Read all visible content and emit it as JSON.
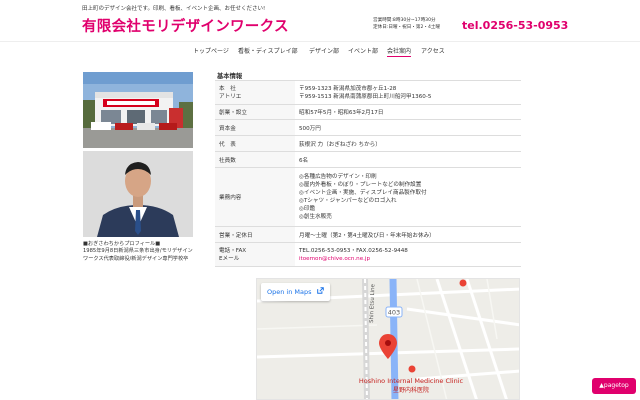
{
  "header": {
    "tagline": "田上町のデザイン会社です。印刷、看板、イベント企画、お任せください!",
    "title": "有限会社モリデザインワークス",
    "hours_line1": "営業時間:8時30分~17時30分",
    "hours_line2": "定休日:日曜・祝日・第2・4土曜",
    "phone": "tel.0256-53-0953"
  },
  "nav": {
    "items": [
      {
        "label": "トップページ"
      },
      {
        "label": "看板・ディスプレイ部"
      },
      {
        "label": "デザイン部"
      },
      {
        "label": "イベント部"
      },
      {
        "label": "会社案内"
      },
      {
        "label": "アクセス"
      }
    ],
    "active_index": 4
  },
  "profile": {
    "caption_title": "■おぎさわちからプロフィール■",
    "caption_body": "1985年9月8日新潟県三条市出身/モリデザインワークス代表取締役/新潟デザイン専門学校卒"
  },
  "info": {
    "section_title": "基本情報",
    "rows": [
      {
        "keys": [
          "本　社",
          "アトリエ"
        ],
        "values": [
          "〒959-1323 新潟県加茂市郡ヶ丘1-28",
          "〒959-1513 新潟県南蒲原郡田上町川船河甲1360-5"
        ],
        "pink": false
      },
      {
        "keys": [
          "創業・設立"
        ],
        "values": [
          "昭和57年5月・昭和63年2月17日"
        ],
        "pink": false
      },
      {
        "keys": [
          "資本金"
        ],
        "values": [
          "500万円"
        ],
        "pink": false
      },
      {
        "keys": [
          "代　表"
        ],
        "values": [
          "荻根沢 力（おぎねざわ ちから）"
        ],
        "pink": false
      },
      {
        "keys": [
          "社員数"
        ],
        "values": [
          "6名"
        ],
        "pink": false
      },
      {
        "keys": [
          "業務内容"
        ],
        "values": [
          "◎各種広告物のデザイン・印刷",
          "◎屋内外看板・のぼり・プレートなどの制作設置",
          "◎イベント企画・実施、ディスプレイ商品製作取付",
          "◎Tシャツ・ジャンパーなどのロゴ入れ",
          "◎印鑑",
          "◎創生水販売"
        ],
        "pink": false
      },
      {
        "keys": [
          "営業・定休日"
        ],
        "values": [
          "月曜～土曜（第2・第4土曜及び日・年末年始お休み）"
        ],
        "pink": false
      },
      {
        "keys": [
          "電話・FAX",
          "Eメール"
        ],
        "values": [
          "TEL.0256-53-0953・FAX.0256-52-9448"
        ],
        "pink_values": [
          "itoemon@chive.ocn.ne.jp"
        ],
        "pink": true
      }
    ]
  },
  "map": {
    "open_label": "Open in Maps",
    "road_label": "Shin Etsu Line",
    "route_number": "403",
    "poi_en": "Hoshino Internal Medicine Clinic",
    "poi_ja": "星野内科医院",
    "colors": {
      "road": "#ffffff",
      "highway": "#8ab4f8",
      "marker": "#ea4335",
      "poi": "#ea4335"
    }
  },
  "pagetop": {
    "label": "▲pagetop"
  },
  "colors": {
    "accent": "#e0006d",
    "row_key_bg": "#f7f7f7",
    "border": "#dddddd"
  }
}
